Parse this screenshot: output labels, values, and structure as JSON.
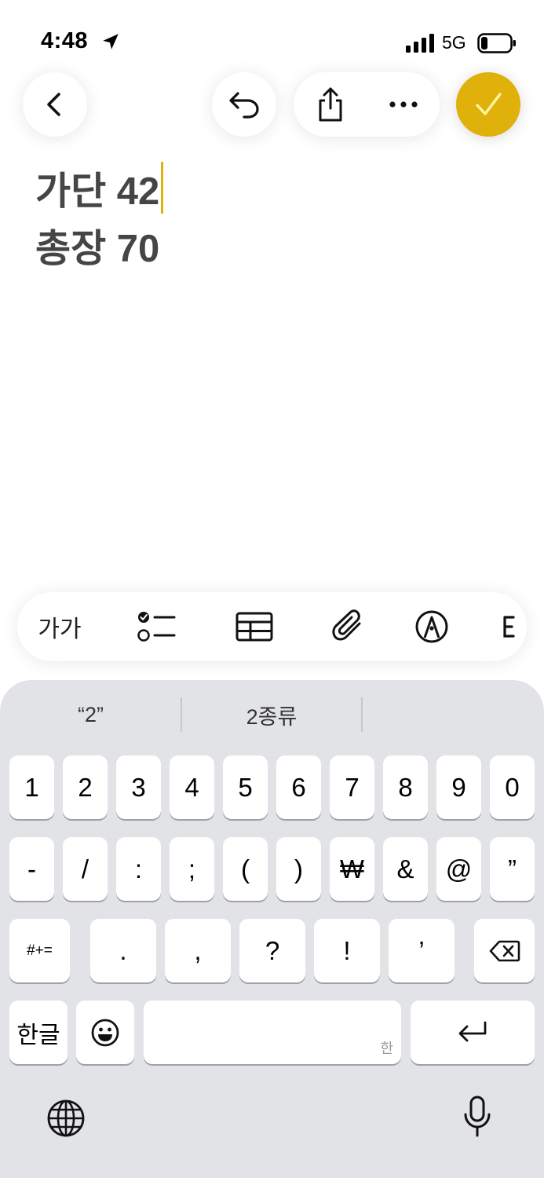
{
  "status_bar": {
    "time": "4:48",
    "network": "5G"
  },
  "note": {
    "lines": [
      "가단 42",
      "총장 70"
    ]
  },
  "format_bar": {
    "text_style_label": "가가"
  },
  "keyboard": {
    "suggestions": [
      "“2”",
      "2종류",
      ""
    ],
    "row1": [
      "1",
      "2",
      "3",
      "4",
      "5",
      "6",
      "7",
      "8",
      "9",
      "0"
    ],
    "row2": [
      "-",
      "/",
      ":",
      ";",
      "(",
      ")",
      "₩",
      "&",
      "@",
      "”"
    ],
    "row3": [
      ".",
      ",",
      "?",
      "!",
      "’"
    ],
    "symbols_key": "#+=",
    "korean_key": "한글",
    "space_hint": "한"
  },
  "colors": {
    "accent": "#e0b10a",
    "keyboard_bg": "#e2e3e7",
    "text": "#454545"
  }
}
